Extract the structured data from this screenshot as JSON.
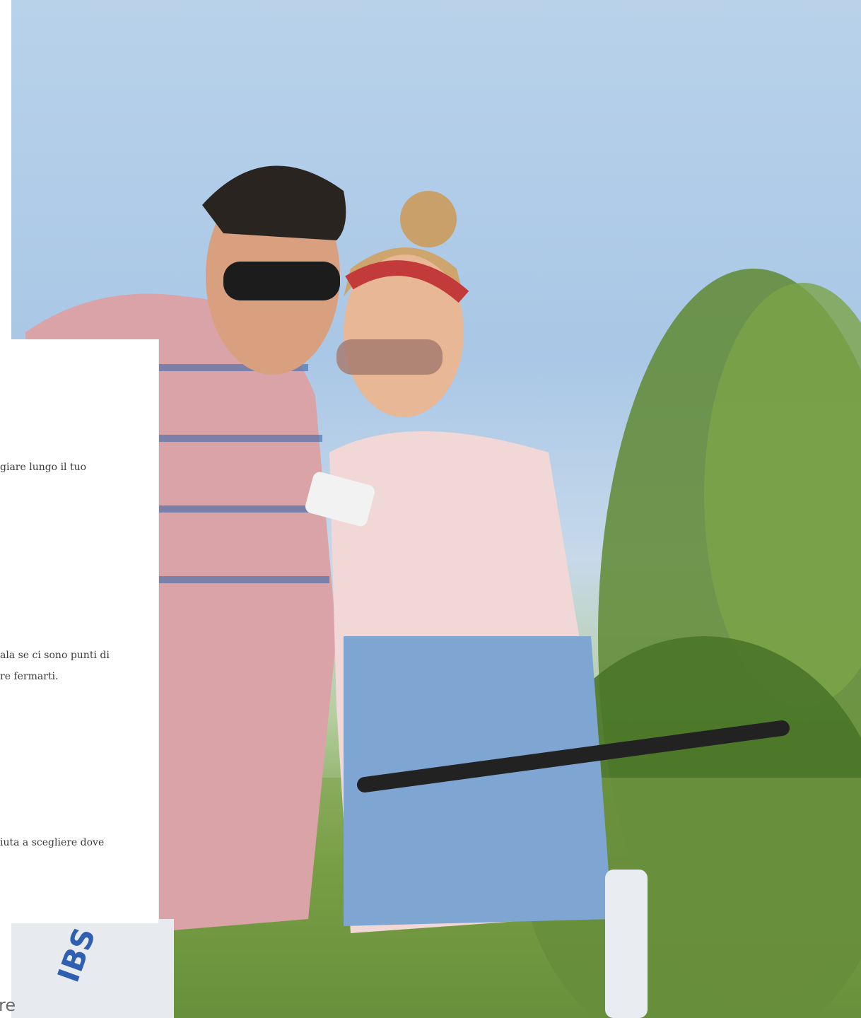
{
  "hero": {
    "image_alt": "Coppia in bicicletta tra i vigneti che guarda uno smartphone"
  },
  "card": {
    "lines": [
      "giare lungo il tuo",
      "ala se ci sono punti di",
      "re fermarti.",
      "iuta a scegliere dove"
    ]
  },
  "footer": {
    "fragment": "re"
  },
  "colors": {
    "sky": "#b9d2ea",
    "vine_green": "#5f8a33",
    "card_bg": "#ffffff",
    "text": "#3a3a3a"
  }
}
